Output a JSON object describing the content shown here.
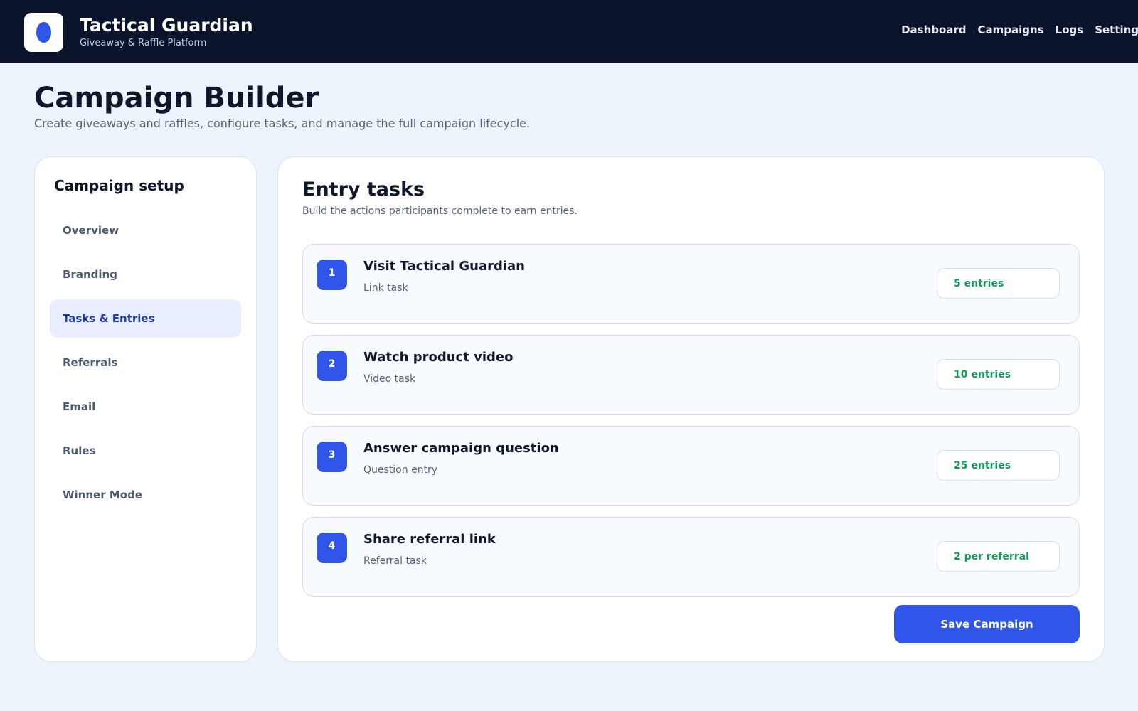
{
  "app": {
    "title": "Tactical Guardian",
    "subtitle": "Giveaway & Raffle Platform",
    "logo_icon": "shield-logo-icon"
  },
  "nav": {
    "items": [
      "Dashboard",
      "Campaigns",
      "Logs",
      "Settings"
    ]
  },
  "page": {
    "title": "Campaign Builder",
    "subtitle": "Create giveaways and raffles, configure tasks, and manage the full campaign lifecycle."
  },
  "sidebar": {
    "title": "Campaign setup",
    "active": "Tasks & Entries",
    "items": [
      "Overview",
      "Branding",
      "Tasks & Entries",
      "Referrals",
      "Email",
      "Rules",
      "Winner Mode"
    ]
  },
  "tasks": {
    "title": "Entry tasks",
    "subtitle": "Build the actions participants complete to earn entries.",
    "items": [
      {
        "number": "1",
        "title": "Visit Tactical Guardian",
        "type": "Link task",
        "entries": "5 entries"
      },
      {
        "number": "2",
        "title": "Watch product video",
        "type": "Video task",
        "entries": "10 entries"
      },
      {
        "number": "3",
        "title": "Answer campaign question",
        "type": "Question entry",
        "entries": "25 entries"
      },
      {
        "number": "4",
        "title": "Share referral link",
        "type": "Referral task",
        "entries": "2 per referral"
      }
    ]
  },
  "actions": {
    "save_label": "Save Campaign"
  },
  "colors": {
    "header_bg": "#0b142b",
    "accent": "#2f55e9",
    "entries_green": "#0f9d58",
    "page_bg": "#edf3fb"
  }
}
